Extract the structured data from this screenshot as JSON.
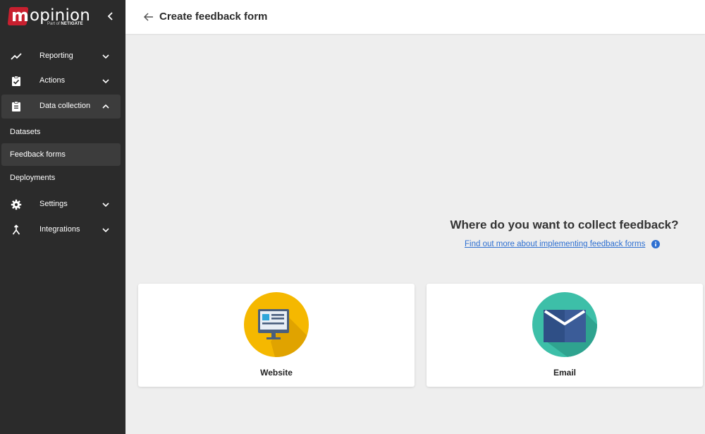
{
  "brand": {
    "mark": "m",
    "word": "opinion",
    "sub_prefix": "Part of",
    "sub_company": "NETIGATE"
  },
  "header": {
    "title": "Create feedback form"
  },
  "sidebar": {
    "items": [
      {
        "label": "Reporting",
        "icon": "trending-up-icon"
      },
      {
        "label": "Actions",
        "icon": "clipboard-check-icon"
      },
      {
        "label": "Data collection",
        "icon": "clipboard-list-icon",
        "expanded": true
      },
      {
        "label": "Settings",
        "icon": "gear-icon"
      },
      {
        "label": "Integrations",
        "icon": "merge-icon"
      }
    ],
    "sub_items": [
      {
        "label": "Datasets"
      },
      {
        "label": "Feedback forms",
        "active": true
      },
      {
        "label": "Deployments"
      }
    ]
  },
  "main": {
    "question": "Where do you want to collect feedback?",
    "help_link": "Find out more about implementing feedback forms",
    "options": [
      {
        "label": "Website",
        "icon": "website-monitor-icon",
        "color": "#f5b800"
      },
      {
        "label": "Email",
        "icon": "email-envelope-icon",
        "color": "#3dbfa8"
      }
    ]
  },
  "colors": {
    "sidebar_bg": "#2b2b2b",
    "brand_red": "#c8202f",
    "link": "#2d6fd1",
    "page_bg": "#eeeeee"
  }
}
